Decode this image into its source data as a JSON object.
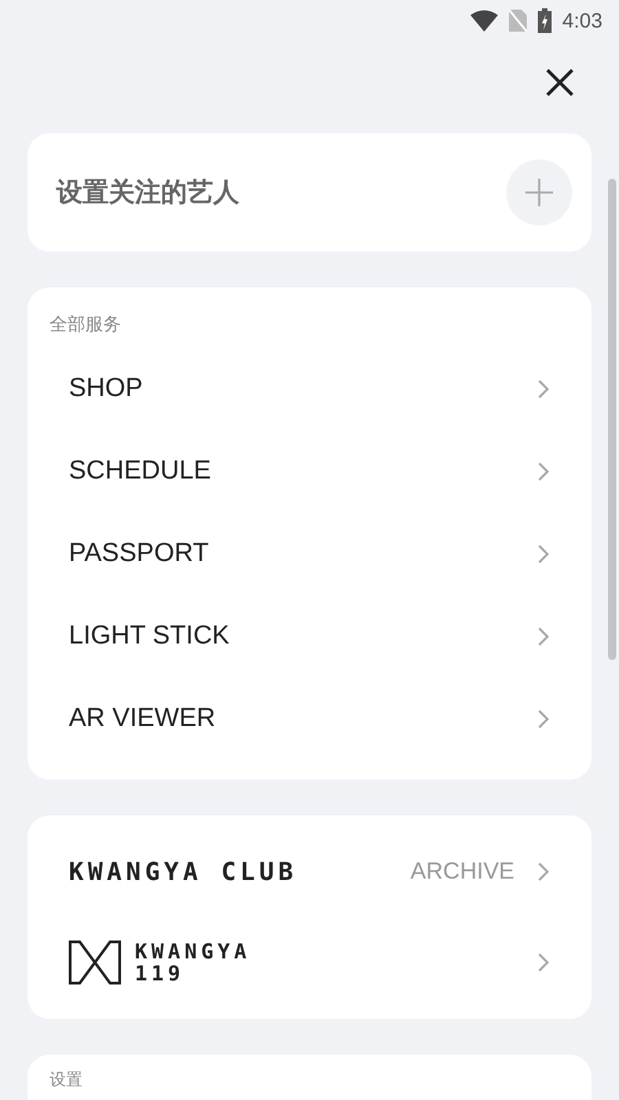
{
  "status_bar": {
    "time": "4:03"
  },
  "follow_card": {
    "label": "设置关注的艺人"
  },
  "services": {
    "title": "全部服务",
    "items": [
      {
        "label": "SHOP"
      },
      {
        "label": "SCHEDULE"
      },
      {
        "label": "PASSPORT"
      },
      {
        "label": "LIGHT STICK"
      },
      {
        "label": "AR VIEWER"
      }
    ]
  },
  "brands": [
    {
      "kind": "club",
      "logo_text": "KWANGYA CLUB",
      "link": "ARCHIVE"
    },
    {
      "kind": "mark",
      "logo_lines": [
        "KWANGYA",
        "119"
      ]
    }
  ],
  "settings": {
    "title": "设置"
  }
}
